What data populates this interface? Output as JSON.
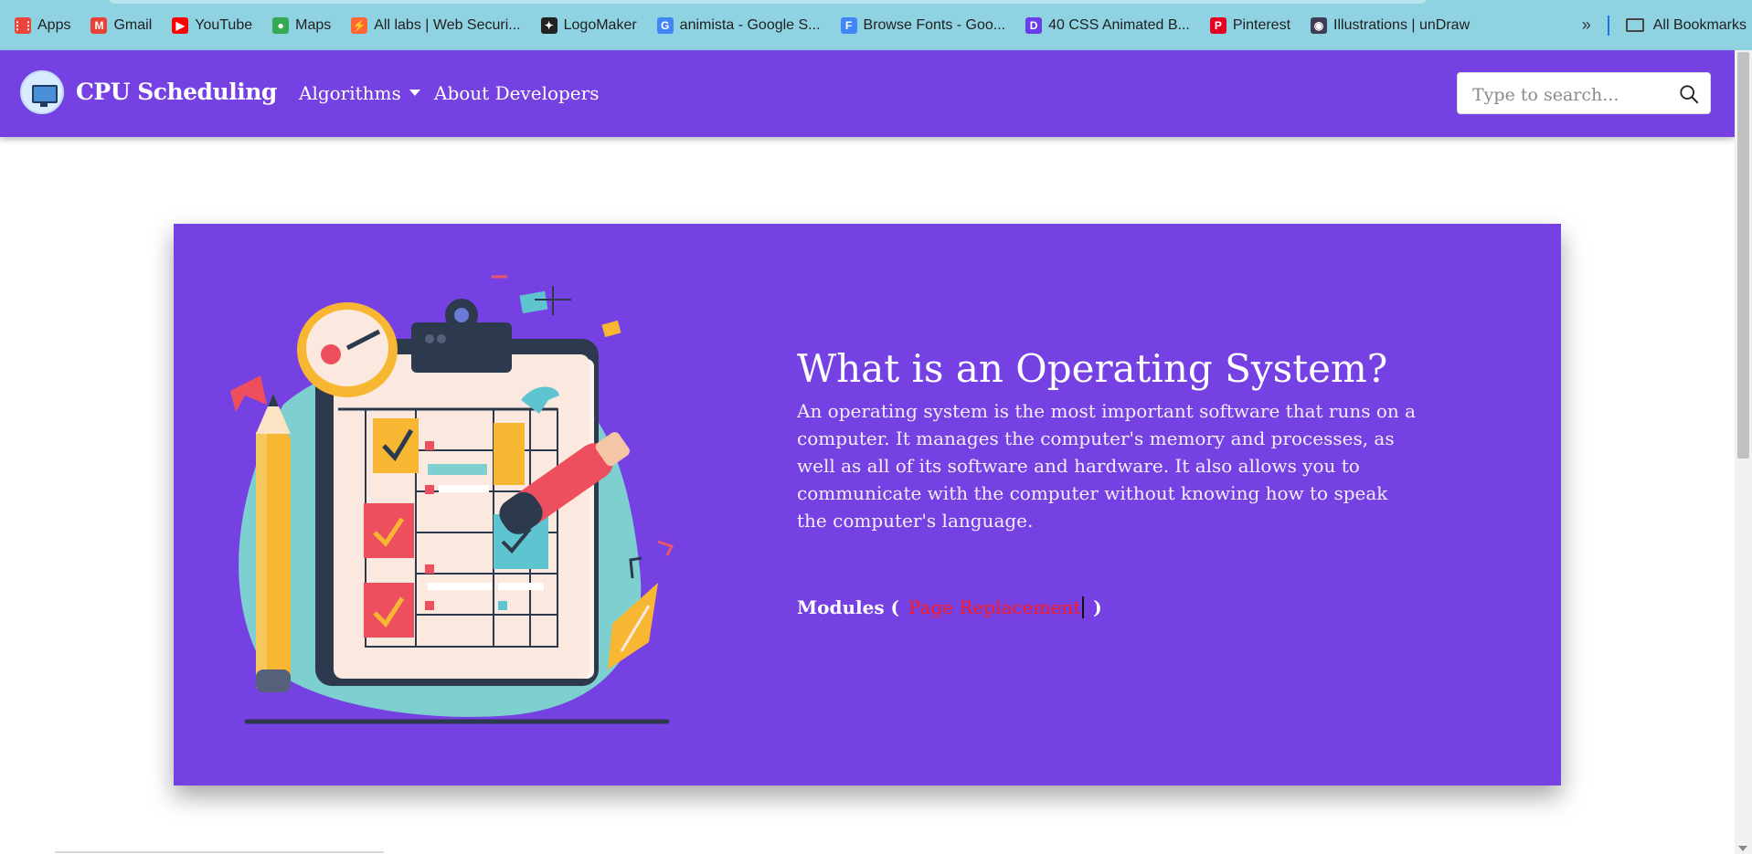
{
  "bookmarks": {
    "items": [
      {
        "label": "Apps",
        "icon": "apps-grid-icon",
        "color": "#e8453c"
      },
      {
        "label": "Gmail",
        "icon": "gmail-icon",
        "color": "#ea4335"
      },
      {
        "label": "YouTube",
        "icon": "youtube-icon",
        "color": "#ff0000"
      },
      {
        "label": "Maps",
        "icon": "maps-pin-icon",
        "color": "#34a853"
      },
      {
        "label": "All labs | Web Securi...",
        "icon": "portswigger-icon",
        "color": "#ff6633"
      },
      {
        "label": "LogoMaker",
        "icon": "logomaker-icon",
        "color": "#222222"
      },
      {
        "label": "animista - Google S...",
        "icon": "google-icon",
        "color": "#4285f4"
      },
      {
        "label": "Browse Fonts - Goo...",
        "icon": "google-fonts-icon",
        "color": "#4285f4"
      },
      {
        "label": "40 CSS Animated B...",
        "icon": "site-icon",
        "color": "#6a3de8"
      },
      {
        "label": "Pinterest",
        "icon": "pinterest-icon",
        "color": "#e60023"
      },
      {
        "label": "Illustrations | unDraw",
        "icon": "undraw-icon",
        "color": "#3f3d56"
      }
    ],
    "overflow": "»",
    "all_bookmarks": "All Bookmarks"
  },
  "navbar": {
    "brand": "CPU Scheduling",
    "links": [
      "Algorithms",
      "About Developers"
    ],
    "search_placeholder": "Type to search..."
  },
  "hero": {
    "title": "What is an Operating System?",
    "description": "An operating system is the most important software that runs on a computer. It manages the computer's memory and processes, as well as all of its software and hardware. It also allows you to communicate with the computer without knowing how to speak the computer's language.",
    "modules_label": "Modules (",
    "modules_link": "Page Replacement",
    "modules_close": ")"
  },
  "colors": {
    "bookmarks_bar": "#8fd3e3",
    "primary": "#7641e2",
    "module_link": "#ff1a1a"
  }
}
